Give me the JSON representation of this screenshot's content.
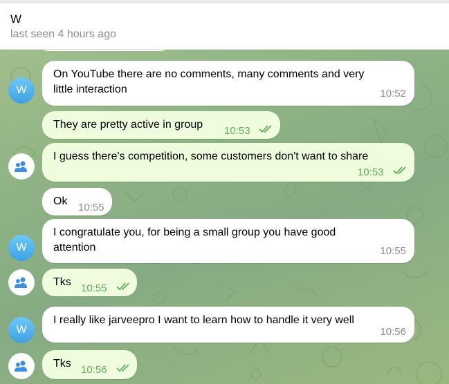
{
  "header": {
    "title": "W",
    "status": "last seen 4 hours ago"
  },
  "avatars": {
    "contact_initial": "W"
  },
  "messages": [
    {
      "text": "On YouTube there are no comments, many comments and very\nlittle interaction",
      "time": "10:52",
      "outgoing": false
    },
    {
      "text": "They are pretty active in group",
      "time": "10:53",
      "outgoing": true
    },
    {
      "text": "I guess there's competition, some customers don't want to share",
      "time": "10:53",
      "outgoing": true
    },
    {
      "text": "Ok",
      "time": "10:55",
      "outgoing": false
    },
    {
      "text": "I congratulate you, for being a small group you have good\nattention",
      "time": "10:55",
      "outgoing": false
    },
    {
      "text": "Tks",
      "time": "10:55",
      "outgoing": true
    },
    {
      "text": "I really like jarveepro I want to learn how to handle it very well",
      "time": "10:56",
      "outgoing": false
    },
    {
      "text": "Tks",
      "time": "10:56",
      "outgoing": true
    }
  ],
  "colors": {
    "incoming_bubble": "#ffffff",
    "outgoing_bubble": "#effdde",
    "read_check": "#5fad5a",
    "avatar_w": "#3ea0e0"
  }
}
